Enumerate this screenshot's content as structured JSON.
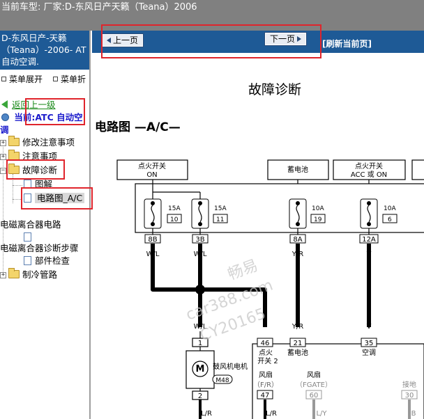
{
  "title_bar": {
    "text": "当前车型:  厂家:D-东风日产天籁（Teana）2006"
  },
  "sidebar": {
    "header_line1": "D-东风日产-天籁",
    "header_line2": "（Teana）-2006- AT",
    "header_line3": "自动空调.",
    "expand_label": "菜单展开",
    "collapse_label": "菜单折",
    "back_label": "返回上一级",
    "current_label": "当前:ATC 自动空",
    "current_cont": "调",
    "tree": [
      {
        "label": "修改注意事项"
      },
      {
        "label": "注意事项"
      },
      {
        "label": "故障诊断"
      },
      {
        "label": "图解"
      },
      {
        "label": "电路图_A/C"
      },
      {
        "label": "电磁离合器电路"
      },
      {
        "label": "电磁离合器诊断步骤"
      },
      {
        "label": "部件检查"
      },
      {
        "label": "制冷管路"
      }
    ]
  },
  "navbar": {
    "prev_label": "上一页",
    "next_label": "下一页",
    "refresh_label": "[刷新当前页]"
  },
  "content": {
    "page_heading": "故障诊断",
    "diagram_title": "电路图 —A/C—"
  },
  "diagram": {
    "power_boxes": [
      {
        "line1": "点火开关",
        "line2": "ON"
      },
      {
        "line1": "蓄电池",
        "line2": ""
      },
      {
        "line1": "点火开关",
        "line2": "ACC 或 ON"
      }
    ],
    "fuses": [
      {
        "amp": "15A",
        "num": "10"
      },
      {
        "amp": "15A",
        "num": "11"
      },
      {
        "amp": "10A",
        "num": "19"
      },
      {
        "amp": "10A",
        "num": "6"
      }
    ],
    "connectors_top": [
      "8B",
      "3B",
      "8A",
      "12A"
    ],
    "wire_top": [
      "W/L",
      "W/L",
      "Y/R",
      "V"
    ],
    "wire_mid": [
      "W/L",
      "Y/R",
      "V"
    ],
    "module_pins": [
      "46",
      "21",
      "35"
    ],
    "module_pin_labels": [
      "点火",
      "开关 2",
      "蓄电池",
      "空调"
    ],
    "motor_pins": [
      "1",
      "2"
    ],
    "motor_name": "鼓风机电机",
    "motor_code": "M48",
    "bottom_labels": [
      {
        "line1": "风扇",
        "line2": "（F/R）",
        "pin": "47"
      },
      {
        "line1": "风扇",
        "line2": "（FGATE）",
        "pin": "60"
      },
      {
        "line1": "接地",
        "line2": "",
        "pin": "30"
      }
    ],
    "wire_bottom": [
      "L/R",
      "L/R",
      "L/Y",
      "B"
    ],
    "watermark1": "畅易",
    "watermark2": "car388.com",
    "watermark3": "CY20165"
  }
}
